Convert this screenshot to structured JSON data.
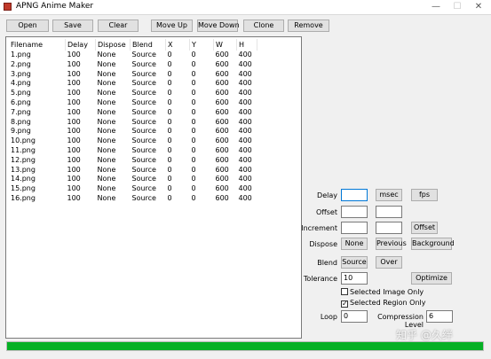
{
  "window": {
    "title": "APNG Anime Maker",
    "minimize": "—",
    "maximize": "☐",
    "close": "✕"
  },
  "toolbar": {
    "open": "Open",
    "save": "Save",
    "clear": "Clear",
    "move_up": "Move Up",
    "move_down": "Move Down",
    "clone": "Clone",
    "remove": "Remove"
  },
  "table": {
    "headers": [
      "Filename",
      "Delay",
      "Dispose",
      "Blend",
      "X",
      "Y",
      "W",
      "H"
    ],
    "rows": [
      [
        "1.png",
        "100",
        "None",
        "Source",
        "0",
        "0",
        "600",
        "400"
      ],
      [
        "2.png",
        "100",
        "None",
        "Source",
        "0",
        "0",
        "600",
        "400"
      ],
      [
        "3.png",
        "100",
        "None",
        "Source",
        "0",
        "0",
        "600",
        "400"
      ],
      [
        "4.png",
        "100",
        "None",
        "Source",
        "0",
        "0",
        "600",
        "400"
      ],
      [
        "5.png",
        "100",
        "None",
        "Source",
        "0",
        "0",
        "600",
        "400"
      ],
      [
        "6.png",
        "100",
        "None",
        "Source",
        "0",
        "0",
        "600",
        "400"
      ],
      [
        "7.png",
        "100",
        "None",
        "Source",
        "0",
        "0",
        "600",
        "400"
      ],
      [
        "8.png",
        "100",
        "None",
        "Source",
        "0",
        "0",
        "600",
        "400"
      ],
      [
        "9.png",
        "100",
        "None",
        "Source",
        "0",
        "0",
        "600",
        "400"
      ],
      [
        "10.png",
        "100",
        "None",
        "Source",
        "0",
        "0",
        "600",
        "400"
      ],
      [
        "11.png",
        "100",
        "None",
        "Source",
        "0",
        "0",
        "600",
        "400"
      ],
      [
        "12.png",
        "100",
        "None",
        "Source",
        "0",
        "0",
        "600",
        "400"
      ],
      [
        "13.png",
        "100",
        "None",
        "Source",
        "0",
        "0",
        "600",
        "400"
      ],
      [
        "14.png",
        "100",
        "None",
        "Source",
        "0",
        "0",
        "600",
        "400"
      ],
      [
        "15.png",
        "100",
        "None",
        "Source",
        "0",
        "0",
        "600",
        "400"
      ],
      [
        "16.png",
        "100",
        "None",
        "Source",
        "0",
        "0",
        "600",
        "400"
      ]
    ]
  },
  "panel": {
    "delay_label": "Delay",
    "delay_value": "",
    "msec": "msec",
    "fps": "fps",
    "offset_label": "Offset",
    "offset_value1": "",
    "offset_value2": "",
    "increment_label": "Increment",
    "increment_value1": "",
    "increment_value2": "",
    "offset_button": "Offset",
    "dispose_label": "Dispose",
    "dispose_none": "None",
    "dispose_previous": "Previous",
    "dispose_background": "Background",
    "blend_label": "Blend",
    "blend_source": "Source",
    "blend_over": "Over",
    "tolerance_label": "Tolerance",
    "tolerance_value": "10",
    "optimize": "Optimize",
    "selected_image_only": "Selected Image Only",
    "selected_image_only_checked": false,
    "selected_region_only": "Selected Region Only",
    "selected_region_only_checked": true,
    "loop_label": "Loop",
    "loop_value": "0",
    "compression_label": "Compression Level",
    "compression_value": "6"
  },
  "progress": {
    "value": 1.0,
    "color": "#06b025"
  },
  "watermark": "知乎 @久绊"
}
